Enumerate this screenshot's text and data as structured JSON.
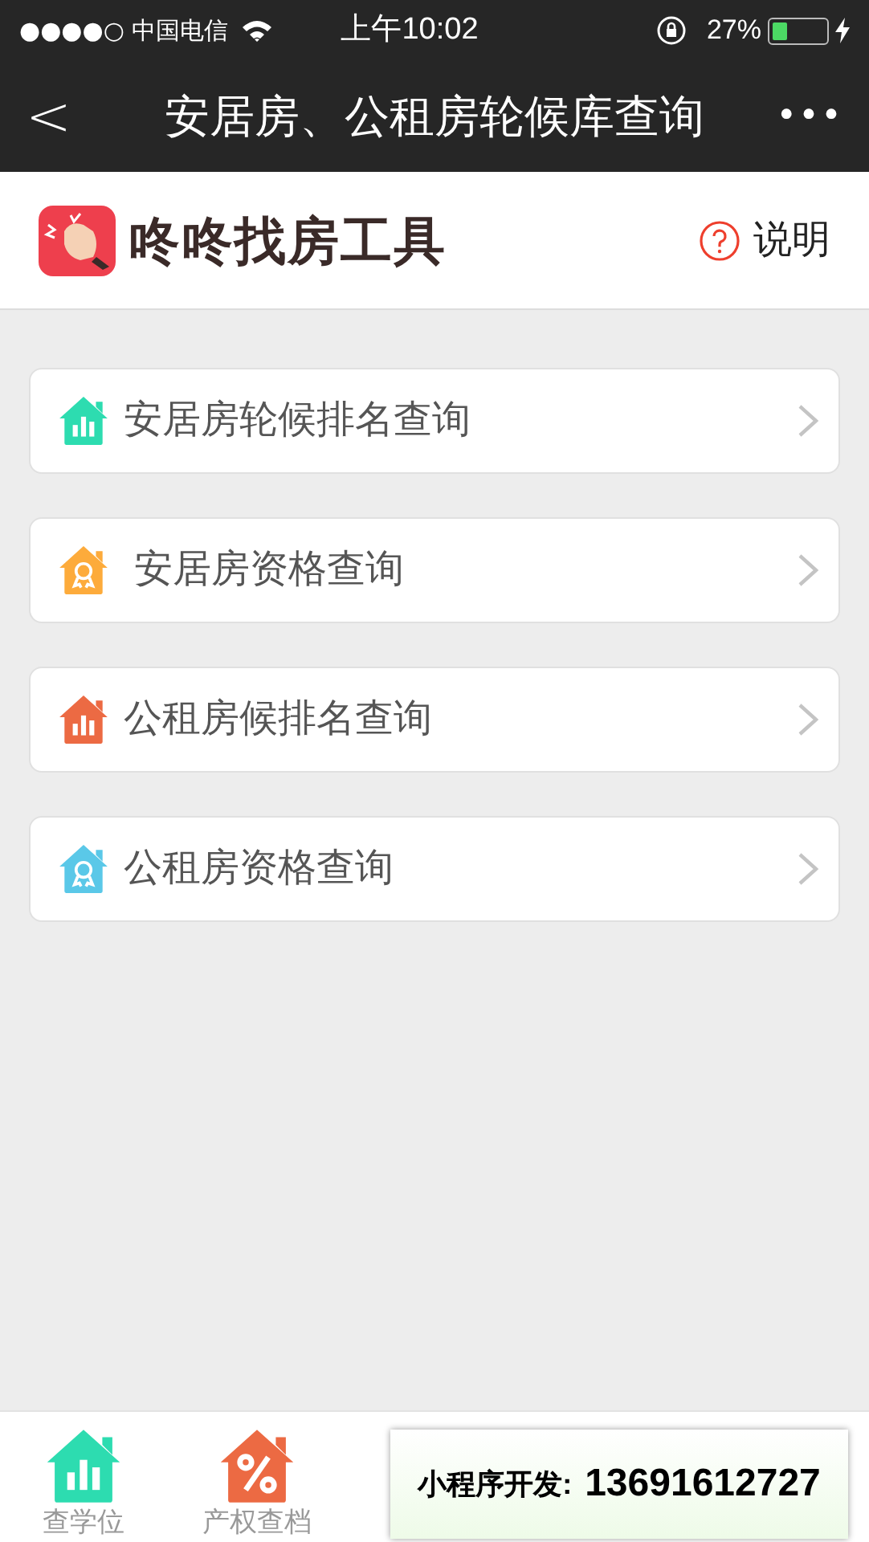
{
  "status_bar": {
    "carrier": "●●●●○ 中国电信",
    "time": "上午10:02",
    "battery": "27%"
  },
  "nav": {
    "back": "<",
    "title": "安居房、公租房轮候库查询",
    "more": "•••"
  },
  "header": {
    "brand": "咚咚找房工具",
    "help": "说明"
  },
  "menu": [
    {
      "label": "安居房轮候排名查询",
      "kind": "chart",
      "color": "#2ddcb0"
    },
    {
      "label": " 安居房资格查询",
      "kind": "award",
      "color": "#fdab3b"
    },
    {
      "label": "公租房候排名查询",
      "kind": "chart",
      "color": "#ec6a43"
    },
    {
      "label": "公租房资格查询",
      "kind": "award",
      "color": "#5ac8e8"
    }
  ],
  "tab_bar": [
    {
      "label": "查学位",
      "kind": "chart",
      "color": "#2ddcb0",
      "selected": false
    },
    {
      "label": "产权查档",
      "kind": "percent",
      "color": "#ec6a43",
      "selected": false
    }
  ],
  "overlay": {
    "label": "小程序开发:",
    "phone": "13691612727"
  }
}
